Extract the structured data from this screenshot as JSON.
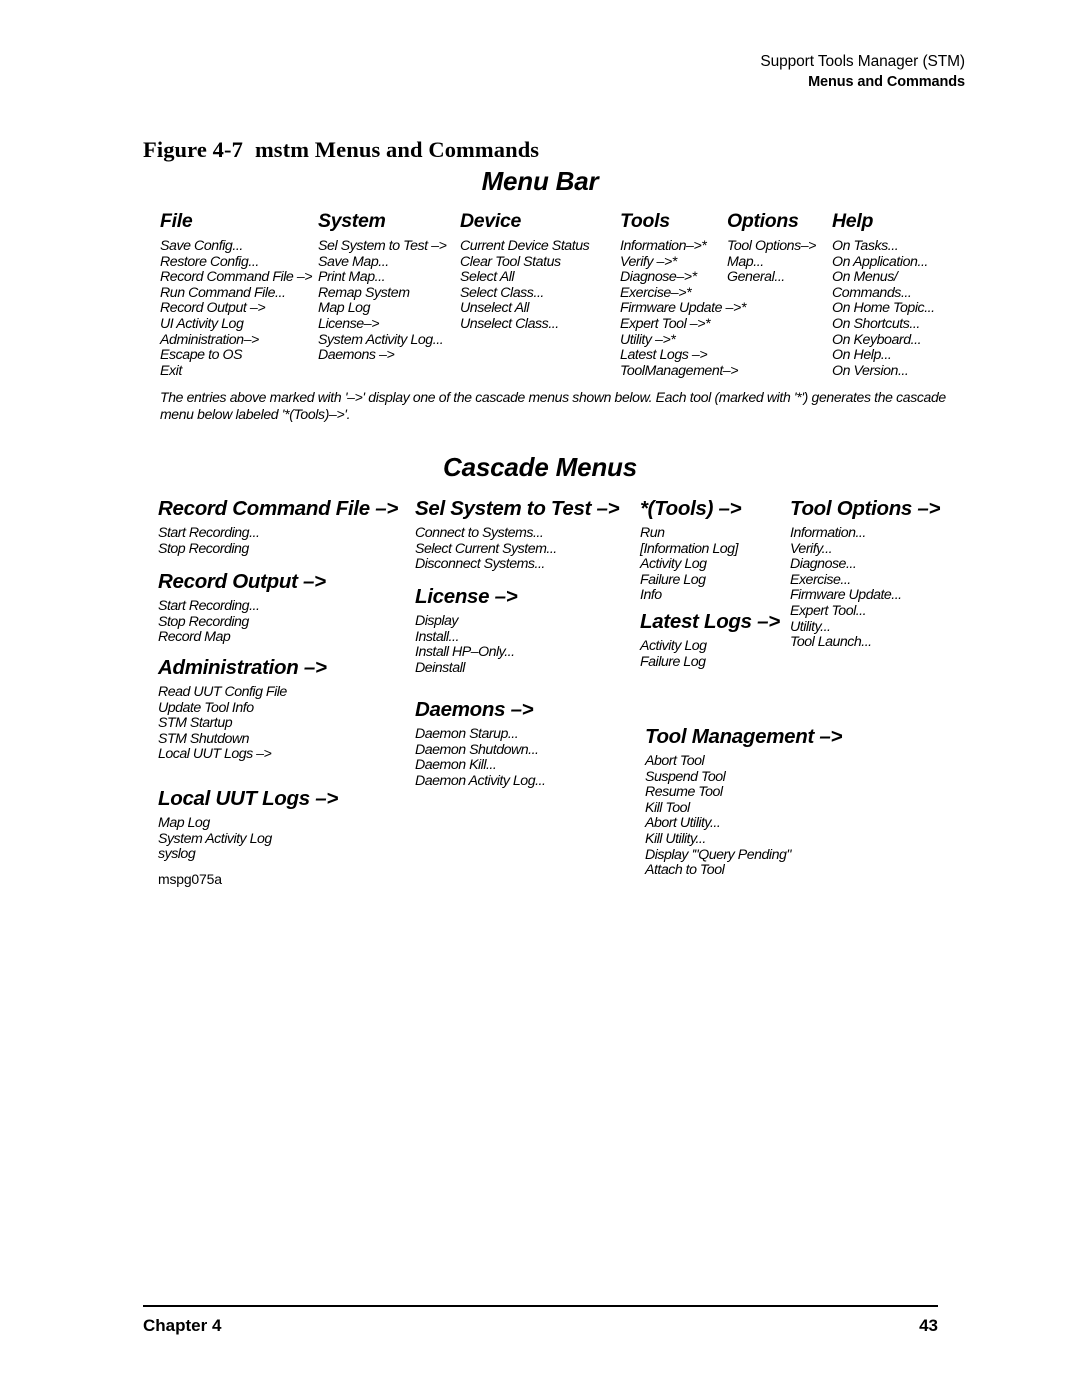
{
  "running_header": {
    "line1": "Support Tools Manager (STM)",
    "line2": "Menus and Commands"
  },
  "figure": {
    "number": "Figure 4-7",
    "caption": "mstm Menus and Commands",
    "art_id": "mspg075a",
    "menu_bar_title": "Menu Bar",
    "cascade_title": "Cascade Menus",
    "note": "The entries above marked with '–>' display one of the cascade menus shown below.  Each tool (marked with '*') generates the cascade menu below labeled '*(Tools)–>'."
  },
  "menu_bar": {
    "columns": [
      {
        "name": "File",
        "items": [
          "Save Config...",
          "Restore Config...",
          "Record Command File –>",
          "Run Command File...",
          "Record Output –>",
          "UI Activity Log",
          "Administration–>",
          "Escape to OS",
          "Exit"
        ]
      },
      {
        "name": "System",
        "items": [
          "Sel System to Test –>",
          "Save Map...",
          "Print Map...",
          "Remap System",
          "Map Log",
          "License–>",
          "System Activity Log...",
          "Daemons –>"
        ]
      },
      {
        "name": "Device",
        "items": [
          "Current Device Status",
          "Clear Tool Status",
          "Select All",
          "Select Class...",
          "Unselect All",
          "Unselect Class..."
        ]
      },
      {
        "name": "Tools",
        "items": [
          "Information–>*",
          "Verify –>*",
          "Diagnose–>*",
          "Exercise–>*",
          "Firmware Update –>*",
          "Expert Tool –>*",
          "Utility –>*",
          "Latest Logs –>",
          "ToolManagement–>"
        ]
      },
      {
        "name": "Options",
        "items": [
          "Tool Options–>",
          "Map...",
          "General..."
        ]
      },
      {
        "name": "Help",
        "items": [
          "On Tasks...",
          "On Application...",
          "On Menus/",
          "Commands...",
          "On Home Topic...",
          "On Shortcuts...",
          "On Keyboard...",
          "On Help...",
          "On Version..."
        ]
      }
    ]
  },
  "cascade_menus": {
    "blocks": [
      {
        "name": "Record Command File –>",
        "items": [
          "Start Recording...",
          "Stop Recording"
        ]
      },
      {
        "name": "Record Output –>",
        "items": [
          "Start Recording...",
          "Stop Recording",
          "Record Map"
        ]
      },
      {
        "name": "Administration –>",
        "items": [
          "Read UUT Config File",
          "Update Tool Info",
          "STM Startup",
          "STM Shutdown",
          "Local UUT Logs –>"
        ]
      },
      {
        "name": "Local UUT Logs –>",
        "items": [
          "Map Log",
          "System Activity Log",
          "syslog"
        ]
      },
      {
        "name": "Sel System to Test –>",
        "items": [
          "Connect to Systems...",
          "Select Current System...",
          "Disconnect Systems..."
        ]
      },
      {
        "name": "License –>",
        "items": [
          "Display",
          "Install...",
          "Install HP–Only...",
          "Deinstall"
        ]
      },
      {
        "name": "Daemons –>",
        "items": [
          "Daemon Starup...",
          "Daemon Shutdown...",
          "Daemon Kill...",
          "Daemon Activity Log..."
        ]
      },
      {
        "name": "*(Tools) –>",
        "items": [
          "Run",
          "[Information Log]",
          "Activity Log",
          "Failure Log",
          "Info"
        ]
      },
      {
        "name": "Latest Logs –>",
        "items": [
          "Activity Log",
          "Failure Log"
        ]
      },
      {
        "name": "Tool Options –>",
        "items": [
          "Information...",
          "Verify...",
          "Diagnose...",
          "Exercise...",
          "Firmware Update...",
          "Expert Tool...",
          "Utility...",
          "Tool Launch..."
        ]
      },
      {
        "name": "Tool Management –>",
        "items": [
          "Abort Tool",
          "Suspend Tool",
          "Resume Tool",
          "Kill Tool",
          "Abort Utility...",
          "Kill Utility...",
          "Display '\"Query Pending\"",
          "Attach to Tool"
        ]
      }
    ]
  },
  "footer": {
    "chapter": "Chapter 4",
    "page": "43"
  }
}
